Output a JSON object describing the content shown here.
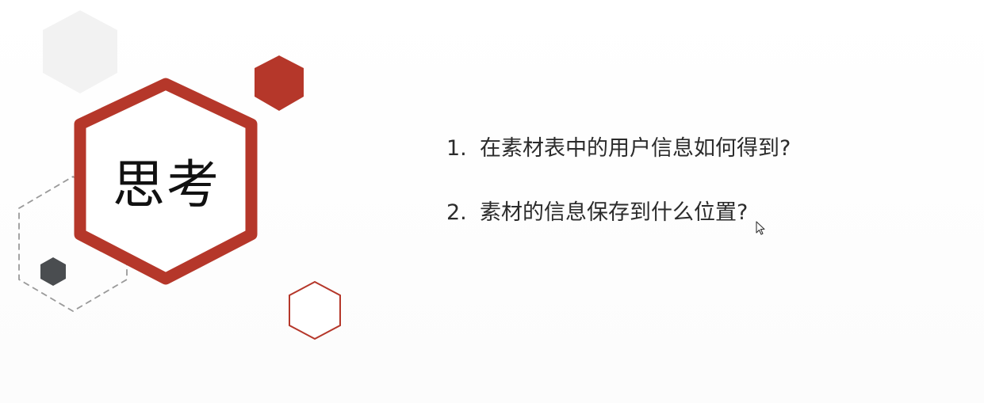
{
  "slide": {
    "title": "思考",
    "questions": [
      {
        "number": "1.",
        "text": "在素材表中的用户信息如何得到?"
      },
      {
        "number": "2.",
        "text": "素材的信息保存到什么位置?"
      }
    ]
  },
  "colors": {
    "accent_red": "#b5372a",
    "light_gray": "#f1f1f1",
    "dark_gray": "#4a4d50",
    "dashed_gray": "#9a9a9a"
  },
  "icons": [
    "mouse-pointer-icon"
  ]
}
